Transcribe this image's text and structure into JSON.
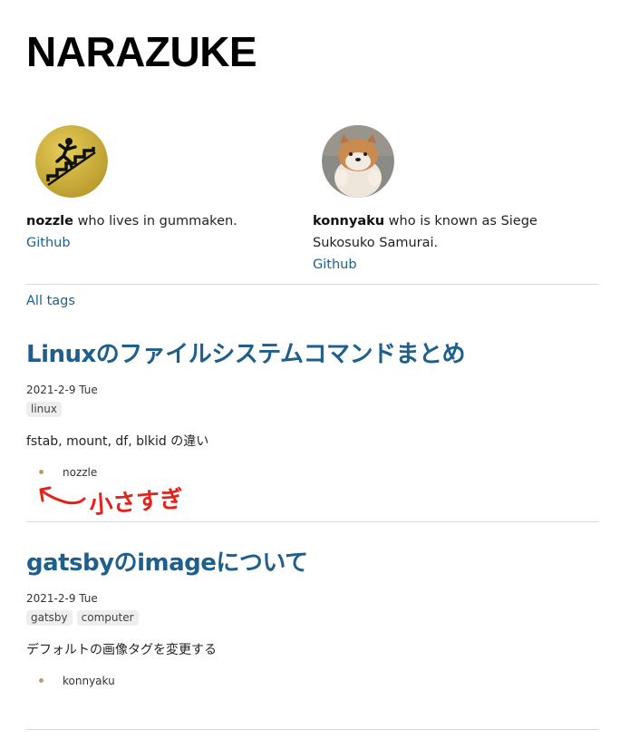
{
  "site": {
    "title": "NARAZUKE"
  },
  "authors": [
    {
      "name": "nozzle",
      "bio": " who lives in gummaken.",
      "link": "Github"
    },
    {
      "name": "konnyaku",
      "bio": " who is known as Siege Sukosuko Samurai.",
      "link": "Github"
    }
  ],
  "nav": {
    "all_tags": "All tags"
  },
  "posts": [
    {
      "title": "Linuxのファイルシステムコマンドまとめ",
      "date": "2021-2-9 Tue",
      "tags": [
        "linux"
      ],
      "excerpt": "fstab, mount, df, blkid の違い",
      "author": "nozzle"
    },
    {
      "title": "gatsbyのimageについて",
      "date": "2021-2-9 Tue",
      "tags": [
        "gatsby",
        "computer"
      ],
      "excerpt": "デフォルトの画像タグを変更する",
      "author": "konnyaku"
    }
  ],
  "annotation": {
    "text": "小さすぎ",
    "color": "#e0241b"
  },
  "colors": {
    "link": "#1f5f8b",
    "rule": "#d9d9d9",
    "tag_bg": "#eeeeee"
  }
}
